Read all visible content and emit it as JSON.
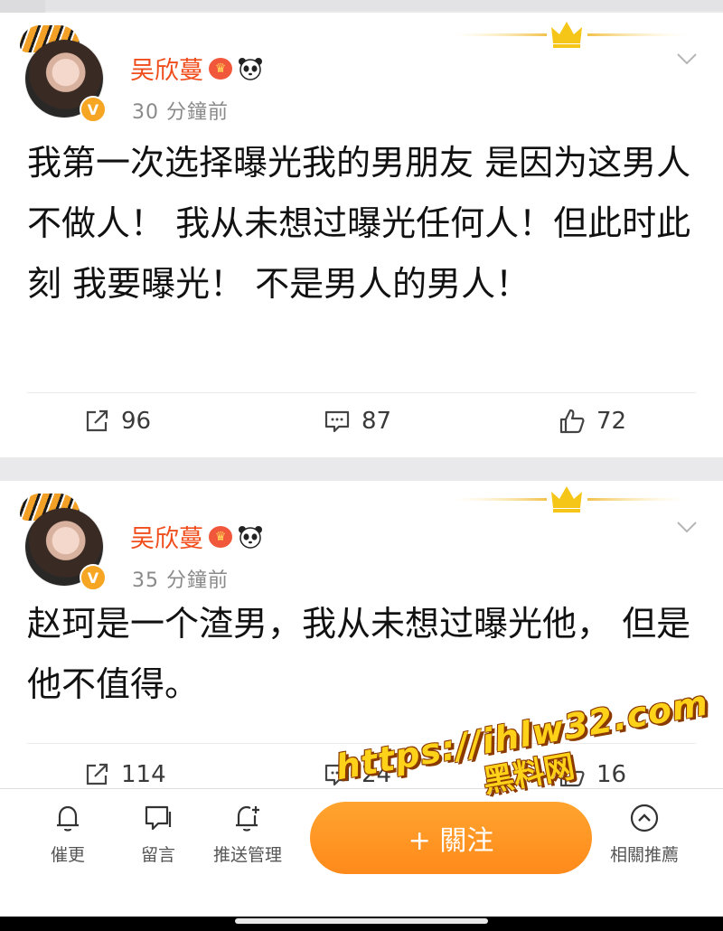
{
  "posts": [
    {
      "username": "吴欣蔓",
      "time": "30 分鐘前",
      "text": "我第一次选择曝光我的男朋友  是因为这男人不做人！  我从未想过曝光任何人！但此时此刻 我要曝光！  不是男人的男人！",
      "reposts": "96",
      "comments": "87",
      "likes": "72"
    },
    {
      "username": "吴欣蔓",
      "time": "35 分鐘前",
      "text": "赵珂是一个渣男，我从未想过曝光他，  但是他不值得。",
      "reposts": "114",
      "comments": "24",
      "likes": "16"
    }
  ],
  "icons": {
    "verified": "verified-v-icon",
    "vip": "crown-badge-icon",
    "panda": "panda-emoji-icon",
    "menu": "chevron-down-icon",
    "repost": "repost-icon",
    "comment": "comment-icon",
    "like": "thumbs-up-icon"
  },
  "bottom_bar": {
    "remind": "催更",
    "message": "留言",
    "push": "推送管理",
    "follow": "+ 關注",
    "recommend": "相關推薦"
  },
  "watermark": {
    "url": "https://ihlw32.com",
    "name": "黑料网"
  },
  "colors": {
    "username": "#f04d1c",
    "follow_button": "#ff961f",
    "verified": "#f6a623",
    "crown": "#f5c518"
  }
}
